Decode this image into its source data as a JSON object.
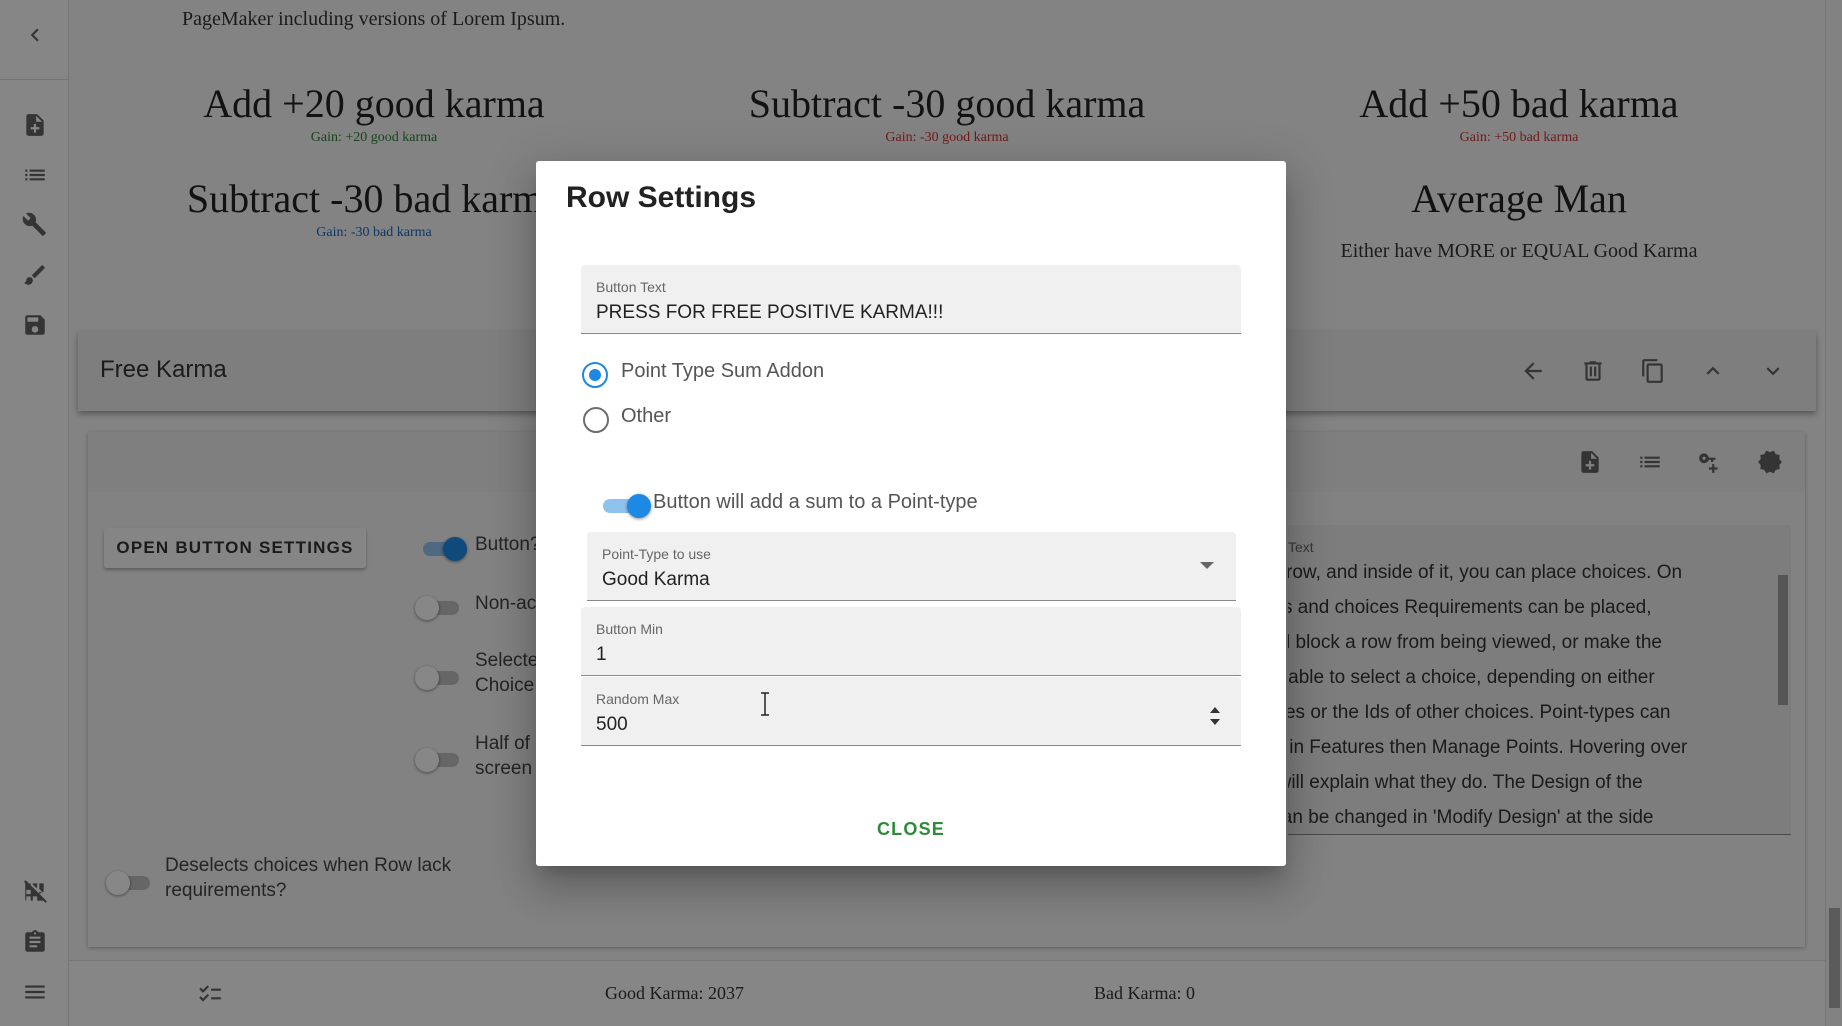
{
  "background": {
    "description_text": "PageMaker including versions of Lorem Ipsum.",
    "choices": [
      {
        "title": "Add +20 good karma",
        "gain": "Gain: +20  good karma",
        "gain_color": "#2e7d32"
      },
      {
        "title": "Subtract -30 good karma",
        "gain": "Gain: -30  good karma",
        "gain_color": "#d32f2f"
      },
      {
        "title": "Add +50 bad karma",
        "gain": "Gain: +50 bad karma",
        "gain_color": "#d32f2f"
      },
      {
        "title": "Subtract -30 bad karma",
        "gain": "Gain: -30 bad karma",
        "gain_color": "#1565c0"
      },
      {
        "title": "Average Man",
        "text": "Either have MORE or EQUAL Good Karma"
      }
    ],
    "row": {
      "title": "Free Karma",
      "open_button_label": "OPEN BUTTON SETTINGS",
      "switch_labels": [
        "Button?",
        "Non-ac",
        "Selecte",
        "Choice",
        "Half of",
        "screen"
      ],
      "deselect_label_1": "Deselects choices when Row lack",
      "deselect_label_2": "requirements?",
      "textarea_label": "Text",
      "textarea_lines": [
        "This is a row, and inside of it, you can place choices. On",
        "both rows and choices Requirements can be placed,",
        "which will block a row from being viewed, or make the",
        "player unable to select a choice, depending on either",
        "Point-types or the Ids of other choices. Point-types can",
        "be made in Features then Manage Points. Hovering over",
        "buttons will explain what they do. The Design of the",
        "project can be changed in 'Modify Design' at the side"
      ]
    },
    "points_bar": {
      "good_karma": "Good Karma: 2037",
      "bad_karma": "Bad Karma: 0"
    }
  },
  "dialog": {
    "title": "Row Settings",
    "button_text": {
      "label": "Button Text",
      "value": "PRESS FOR FREE POSITIVE KARMA!!!"
    },
    "radio_options": [
      {
        "label": "Point Type Sum Addon",
        "checked": true
      },
      {
        "label": "Other",
        "checked": false
      }
    ],
    "toggle": {
      "label": "Button will add a sum to a Point-type",
      "on": true
    },
    "point_type_select": {
      "label": "Point-Type to use",
      "value": "Good Karma"
    },
    "button_min": {
      "label": "Button Min",
      "value": "1"
    },
    "random_max": {
      "label": "Random Max",
      "value": "500"
    },
    "close_label": "CLOSE"
  },
  "colors": {
    "accent_blue": "#1e88e5",
    "close_green": "#2e8b3a",
    "scrim": "rgba(0,0,0,0.46)"
  },
  "icons": {
    "sidebar_top": [
      "chevron-left-icon",
      "add-document-icon",
      "list-icon",
      "tools-icon",
      "brush-icon",
      "save-icon"
    ],
    "sidebar_bottom": [
      "grid-off-icon",
      "clipboard-icon",
      "menu-icon"
    ],
    "row_toolbar": [
      "arrow-left-icon",
      "delete-icon",
      "copy-icon",
      "chevron-up-icon",
      "chevron-down-icon"
    ],
    "panel_head": [
      "add-document-icon",
      "list-icon",
      "key-plus-icon",
      "badge-icon"
    ]
  }
}
